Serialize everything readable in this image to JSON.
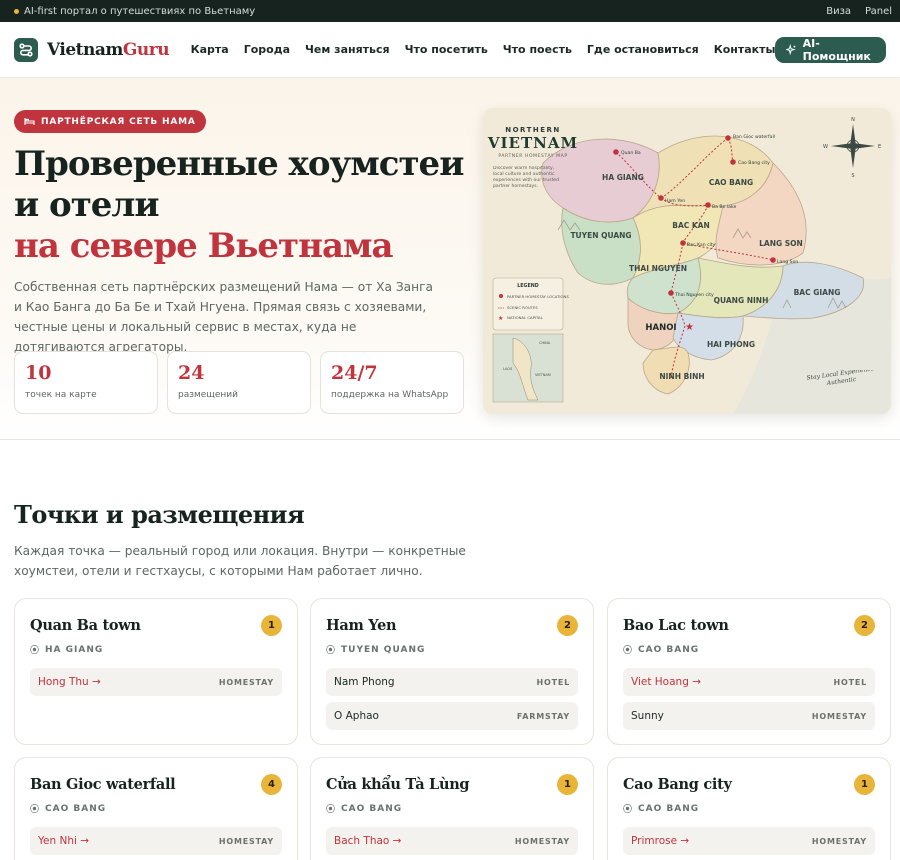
{
  "topbar": {
    "tagline": "AI-first портал о путешествиях по Вьетнаму",
    "links": [
      "Виза",
      "Panel"
    ]
  },
  "header": {
    "logo_main": "Vietnam",
    "logo_accent": "Guru",
    "nav": [
      "Карта",
      "Города",
      "Чем заняться",
      "Что посетить",
      "Что поесть",
      "Где остановиться",
      "Контакты"
    ],
    "ai_button": "AI-Помощник"
  },
  "hero": {
    "badge": "ПАРТНЁРСКАЯ СЕТЬ НАМА",
    "title_line1": "Проверенные хоумстеи и отели",
    "title_line2": "на севере Вьетнама",
    "subtitle": "Собственная сеть партнёрских размещений Нама — от Ха Занга и Као Банга до Ба Бе и Тхай Нгуена. Прямая связь с хозяевами, честные цены и локальный сервис в местах, куда не дотягиваются агрегаторы.",
    "stats": [
      {
        "value": "10",
        "label": "точек на карте"
      },
      {
        "value": "24",
        "label": "размещений"
      },
      {
        "value": "24/7",
        "label": "поддержка на WhatsApp"
      }
    ]
  },
  "map": {
    "title_small": "NORTHERN",
    "title_big": "VIETNAM",
    "subtitle": "PARTNER HOMESTAY MAP",
    "intro": "Discover warm hospitality, local culture and authentic experiences with our trusted partner homestays.",
    "regions": [
      "HA GIANG",
      "CAO BANG",
      "TUYEN QUANG",
      "BAC KAN",
      "LANG SON",
      "THAI NGUYEN",
      "QUANG NINH",
      "BAC GIANG",
      "HANOI",
      "HAI PHONG",
      "NINH BINH"
    ],
    "points": [
      "Quan Ba",
      "Ban Gioc waterfall",
      "Cao Bang city",
      "Ham Yen",
      "Ba Be lake",
      "Bac Kan city",
      "Lang Son",
      "Thai Nguyen city"
    ],
    "legend": {
      "title": "LEGEND",
      "items": [
        "PARTNER HOMESTAY LOCATIONS",
        "SCENIC ROUTES",
        "NATIONAL CAPITAL"
      ]
    },
    "inset_labels": [
      "CHINA",
      "LAOS",
      "VIETNAM"
    ],
    "slogan": "Stay Local Experience Authentic",
    "compass": [
      "N",
      "S",
      "E",
      "W"
    ]
  },
  "section": {
    "title": "Точки и размещения",
    "subtitle": "Каждая точка — реальный город или локация. Внутри — конкретные хоумстеи, отели и гестхаусы, с которыми Нам работает лично."
  },
  "cards": [
    {
      "title": "Quan Ba town",
      "region": "HA GIANG",
      "count": "1",
      "items": [
        {
          "name": "Hong Thu →",
          "type": "HOMESTAY",
          "link": true
        }
      ]
    },
    {
      "title": "Ham Yen",
      "region": "TUYEN QUANG",
      "count": "2",
      "items": [
        {
          "name": "Nam Phong",
          "type": "HOTEL",
          "link": false
        },
        {
          "name": "O Aphao",
          "type": "FARMSTAY",
          "link": false
        }
      ]
    },
    {
      "title": "Bao Lac town",
      "region": "CAO BANG",
      "count": "2",
      "items": [
        {
          "name": "Viet Hoang →",
          "type": "HOTEL",
          "link": true
        },
        {
          "name": "Sunny",
          "type": "HOMESTAY",
          "link": false
        }
      ]
    },
    {
      "title": "Ban Gioc waterfall",
      "region": "CAO BANG",
      "count": "4",
      "items": [
        {
          "name": "Yen Nhi →",
          "type": "HOMESTAY",
          "link": true
        }
      ]
    },
    {
      "title": "Cửa khẩu Tà Lùng",
      "region": "CAO BANG",
      "count": "1",
      "items": [
        {
          "name": "Bach Thao →",
          "type": "HOMESTAY",
          "link": true
        }
      ]
    },
    {
      "title": "Cao Bang city",
      "region": "CAO BANG",
      "count": "1",
      "items": [
        {
          "name": "Primrose →",
          "type": "HOMESTAY",
          "link": true
        }
      ]
    }
  ],
  "colors": {
    "brand_green": "#2c5b4f",
    "accent_red": "#c0343d",
    "count_yellow": "#e8b53a",
    "topbar": "#16231f"
  }
}
